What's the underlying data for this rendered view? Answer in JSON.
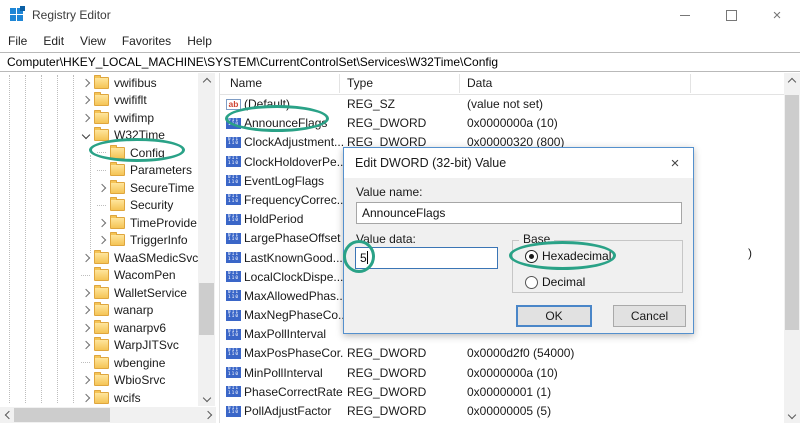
{
  "annotation_color": "#2aa287",
  "window": {
    "icon": "registry-editor-app-icon",
    "title": "Registry Editor",
    "controls": [
      {
        "name": "minimize",
        "glyph": "–"
      },
      {
        "name": "maximize",
        "glyph": "□"
      },
      {
        "name": "close",
        "glyph": "×"
      }
    ]
  },
  "menu": [
    "File",
    "Edit",
    "View",
    "Favorites",
    "Help"
  ],
  "address_bar": {
    "path": "Computer\\HKEY_LOCAL_MACHINE\\SYSTEM\\CurrentControlSet\\Services\\W32Time\\Config"
  },
  "tree": {
    "items": [
      {
        "label": "vwifibus",
        "level": 0,
        "expander": "collapsed"
      },
      {
        "label": "vwififlt",
        "level": 0,
        "expander": "collapsed"
      },
      {
        "label": "vwifimp",
        "level": 0,
        "expander": "collapsed"
      },
      {
        "label": "W32Time",
        "level": 0,
        "expander": "expanded"
      },
      {
        "label": "Config",
        "level": 1,
        "expander": "none",
        "annotated": true
      },
      {
        "label": "Parameters",
        "level": 1,
        "expander": "none"
      },
      {
        "label": "SecureTime",
        "level": 1,
        "expander": "collapsed"
      },
      {
        "label": "Security",
        "level": 1,
        "expander": "none"
      },
      {
        "label": "TimeProvide",
        "level": 1,
        "expander": "collapsed"
      },
      {
        "label": "TriggerInfo",
        "level": 1,
        "expander": "collapsed"
      },
      {
        "label": "WaaSMedicSvc",
        "level": 0,
        "expander": "collapsed"
      },
      {
        "label": "WacomPen",
        "level": 0,
        "expander": "none"
      },
      {
        "label": "WalletService",
        "level": 0,
        "expander": "collapsed"
      },
      {
        "label": "wanarp",
        "level": 0,
        "expander": "collapsed"
      },
      {
        "label": "wanarpv6",
        "level": 0,
        "expander": "collapsed"
      },
      {
        "label": "WarpJITSvc",
        "level": 0,
        "expander": "collapsed"
      },
      {
        "label": "wbengine",
        "level": 0,
        "expander": "none"
      },
      {
        "label": "WbioSrvc",
        "level": 0,
        "expander": "collapsed"
      },
      {
        "label": "wcifs",
        "level": 0,
        "expander": "collapsed"
      }
    ]
  },
  "list": {
    "columns": [
      "Name",
      "Type",
      "Data"
    ],
    "icons": {
      "string_glyph": "ab",
      "dword_glyph": "011 110"
    },
    "rows": [
      {
        "name": "(Default)",
        "icon": "string",
        "type": "REG_SZ",
        "data": "(value not set)"
      },
      {
        "name": "AnnounceFlags",
        "icon": "dword",
        "type": "REG_DWORD",
        "data": "0x0000000a (10)",
        "annotated": true
      },
      {
        "name": "ClockAdjustment...",
        "icon": "dword",
        "type": "REG_DWORD",
        "data": "0x00000320 (800)"
      },
      {
        "name": "ClockHoldoverPe...",
        "icon": "dword",
        "type": "",
        "data": ""
      },
      {
        "name": "EventLogFlags",
        "icon": "dword",
        "type": "",
        "data": ""
      },
      {
        "name": "FrequencyCorrec...",
        "icon": "dword",
        "type": "",
        "data": ""
      },
      {
        "name": "HoldPeriod",
        "icon": "dword",
        "type": "",
        "data": ""
      },
      {
        "name": "LargePhaseOffset",
        "icon": "dword",
        "type": "",
        "data": ""
      },
      {
        "name": "LastKnownGood...",
        "icon": "dword",
        "type": "",
        "data": ""
      },
      {
        "name": "LocalClockDispe...",
        "icon": "dword",
        "type": "",
        "data": ""
      },
      {
        "name": "MaxAllowedPhas...",
        "icon": "dword",
        "type": "",
        "data": ""
      },
      {
        "name": "MaxNegPhaseCo...",
        "icon": "dword",
        "type": "",
        "data": ""
      },
      {
        "name": "MaxPollInterval",
        "icon": "dword",
        "type": "",
        "data": ""
      },
      {
        "name": "MaxPosPhaseCor...",
        "icon": "dword",
        "type": "REG_DWORD",
        "data": "0x0000d2f0 (54000)"
      },
      {
        "name": "MinPollInterval",
        "icon": "dword",
        "type": "REG_DWORD",
        "data": "0x0000000a (10)"
      },
      {
        "name": "PhaseCorrectRate",
        "icon": "dword",
        "type": "REG_DWORD",
        "data": "0x00000001 (1)"
      },
      {
        "name": "PollAdjustFactor",
        "icon": "dword",
        "type": "REG_DWORD",
        "data": "0x00000005 (5)"
      }
    ],
    "overflow_fragment": ")"
  },
  "dialog": {
    "title": "Edit DWORD (32-bit) Value",
    "close_glyph": "×",
    "value_name_label": "Value name:",
    "value_name": "AnnounceFlags",
    "value_data_label": "Value data:",
    "value_data": "5",
    "base_label": "Base",
    "radio_hex": "Hexadecimal",
    "radio_dec": "Decimal",
    "ok_label": "OK",
    "cancel_label": "Cancel"
  }
}
